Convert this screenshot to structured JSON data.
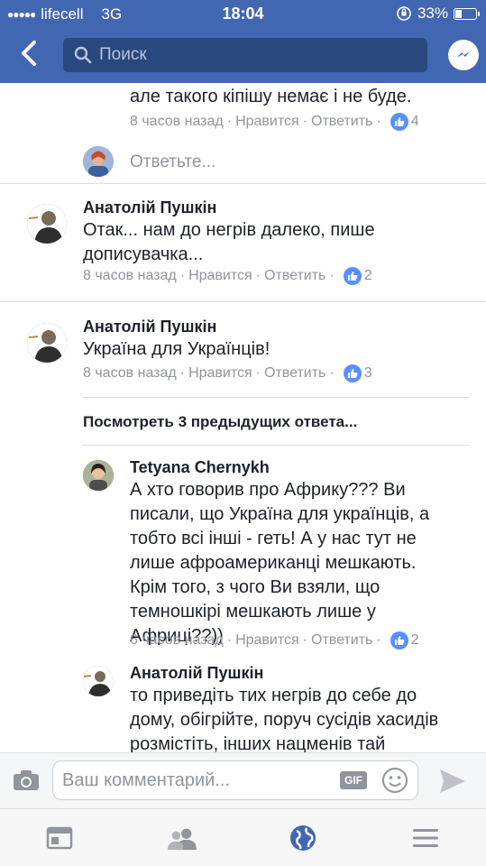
{
  "status": {
    "carrier": "lifecell",
    "network": "3G",
    "time": "18:04",
    "battery": "33%",
    "battery_level": 0.33
  },
  "nav": {
    "search_placeholder": "Поиск"
  },
  "comments": [
    {
      "text_lines": [
        "але такого кіпішу немає і не буде."
      ],
      "time": "8 часов назад",
      "like": "Нравится",
      "reply": "Ответить",
      "likes": "4"
    }
  ],
  "reply_prompt": "Ответьте...",
  "comment2": {
    "author": "Анатолій Пушкін",
    "text_lines": [
      "Отак... нам до негрів далеко, пише",
      "дописувачка..."
    ],
    "time": "8 часов назад",
    "like": "Нравится",
    "reply": "Ответить",
    "likes": "2"
  },
  "comment3": {
    "author": "Анатолій Пушкін",
    "text_lines": [
      "Україна для Українців!"
    ],
    "time": "8 часов назад",
    "like": "Нравится",
    "reply": "Ответить",
    "likes": "3"
  },
  "view_previous": "Посмотреть 3 предыдущих ответа...",
  "reply1": {
    "author": "Tetyana Chernykh",
    "text_lines": [
      "А хто говорив про Африку??? Ви",
      "писали, що Україна для українців, а",
      "тобто всі інші - геть! А у нас тут не",
      "лише афроамериканці мешкають.",
      "Крім того, з чого Ви взяли, що",
      "темношкірі мешкають лише у",
      "Африці??))"
    ],
    "time": "6 часов назад",
    "like": "Нравится",
    "reply": "Ответить",
    "likes": "2"
  },
  "reply2": {
    "author": "Анатолій Пушкін",
    "text_lines": [
      "то приведіть тих негрів до себе до",
      "дому, обігрійте, поруч сусідів хасидів",
      "розмістіть, інших нацменів тай"
    ]
  },
  "composer": {
    "placeholder": "Ваш комментарий...",
    "gif_label": "GIF"
  },
  "colors": {
    "brand": "#4267b2",
    "like_blue": "#5890ff",
    "meta_gray": "#90949c"
  }
}
